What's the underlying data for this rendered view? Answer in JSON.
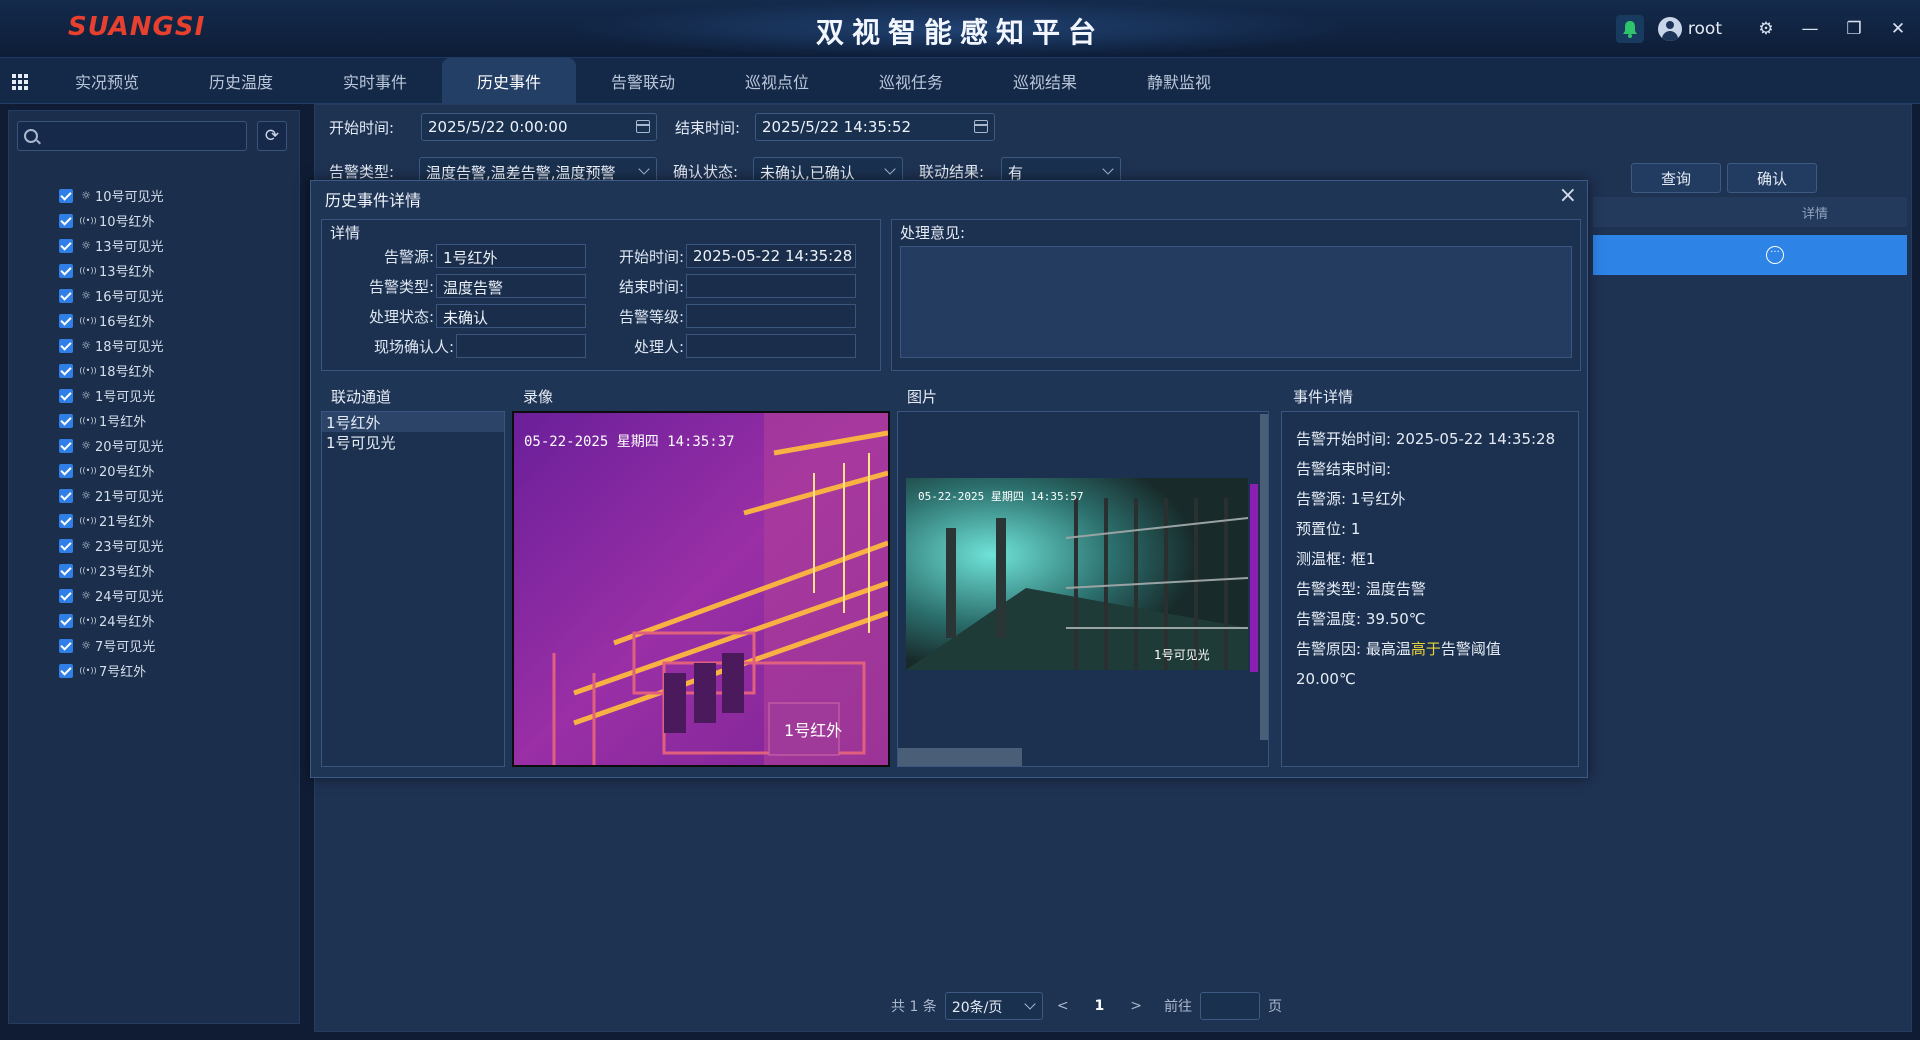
{
  "header": {
    "logo": "SUANGSI",
    "title": "双视智能感知平台",
    "user": "root",
    "icons": [
      "bell-icon",
      "user-icon",
      "gear-icon",
      "minimize-icon",
      "restore-icon",
      "close-icon"
    ]
  },
  "nav": {
    "tabs": [
      "实况预览",
      "历史温度",
      "实时事件",
      "历史事件",
      "告警联动",
      "巡视点位",
      "巡视任务",
      "巡视结果",
      "静默监视"
    ],
    "active": "历史事件"
  },
  "tree": [
    {
      "label": "10号可见光",
      "type": "visible"
    },
    {
      "label": "10号红外",
      "type": "infrared"
    },
    {
      "label": "13号可见光",
      "type": "visible"
    },
    {
      "label": "13号红外",
      "type": "infrared"
    },
    {
      "label": "16号可见光",
      "type": "visible"
    },
    {
      "label": "16号红外",
      "type": "infrared"
    },
    {
      "label": "18号可见光",
      "type": "visible"
    },
    {
      "label": "18号红外",
      "type": "infrared"
    },
    {
      "label": "1号可见光",
      "type": "visible"
    },
    {
      "label": "1号红外",
      "type": "infrared"
    },
    {
      "label": "20号可见光",
      "type": "visible"
    },
    {
      "label": "20号红外",
      "type": "infrared"
    },
    {
      "label": "21号可见光",
      "type": "visible"
    },
    {
      "label": "21号红外",
      "type": "infrared"
    },
    {
      "label": "23号可见光",
      "type": "visible"
    },
    {
      "label": "23号红外",
      "type": "infrared"
    },
    {
      "label": "24号可见光",
      "type": "visible"
    },
    {
      "label": "24号红外",
      "type": "infrared"
    },
    {
      "label": "7号可见光",
      "type": "visible"
    },
    {
      "label": "7号红外",
      "type": "infrared"
    }
  ],
  "filters": {
    "start_label": "开始时间:",
    "start_value": "2025/5/22 0:00:00",
    "end_label": "结束时间:",
    "end_value": "2025/5/22 14:35:52",
    "type_label": "告警类型:",
    "type_value": "温度告警,温差告警,温度预警",
    "confirm_label": "确认状态:",
    "confirm_value": "未确认,已确认",
    "link_label": "联动结果:",
    "link_value": "有",
    "query_btn": "查询",
    "confirm_btn": "确认"
  },
  "table": {
    "col_detail": "详情"
  },
  "pager": {
    "total": "共 1 条",
    "page_size": "20条/页",
    "prev": "<",
    "page": "1",
    "next": ">",
    "goto": "前往",
    "page_unit": "页"
  },
  "modal": {
    "title": "历史事件详情",
    "detail_title": "详情",
    "fields": {
      "source_label": "告警源:",
      "source_value": "1号红外",
      "type_label": "告警类型:",
      "type_value": "温度告警",
      "status_label": "处理状态:",
      "status_value": "未确认",
      "onsite_label": "现场确认人:",
      "onsite_value": "",
      "start_label": "开始时间:",
      "start_value": "2025-05-22 14:35:28",
      "end_label": "结束时间:",
      "end_value": "",
      "level_label": "告警等级:",
      "level_value": "",
      "handler_label": "处理人:",
      "handler_value": ""
    },
    "opinion_label": "处理意见:",
    "channels_title": "联动通道",
    "channels": [
      "1号红外",
      "1号可见光"
    ],
    "video_title": "录像",
    "video_osd": "05-22-2025 星期四 14:35:37",
    "video_label": "1号红外",
    "image_title": "图片",
    "image_osd": "05-22-2025 星期四 14:35:57",
    "image_label": "1号可见光",
    "event_title": "事件详情",
    "event": {
      "start": "告警开始时间:  2025-05-22 14:35:28",
      "end": "告警结束时间:",
      "source": "告警源:  1号红外",
      "preset": "预置位:  1",
      "box": "测温框:  框1",
      "type": "告警类型:  温度告警",
      "temp": "告警温度:  39.50℃",
      "reason_pre": "告警原因:  最高温",
      "reason_hl": "高于",
      "reason_post": "告警阈值",
      "threshold": "20.00℃"
    }
  },
  "colors": {
    "accent": "#2d83e6",
    "highlight": "#e9d13a",
    "logo": "#e8402e"
  }
}
